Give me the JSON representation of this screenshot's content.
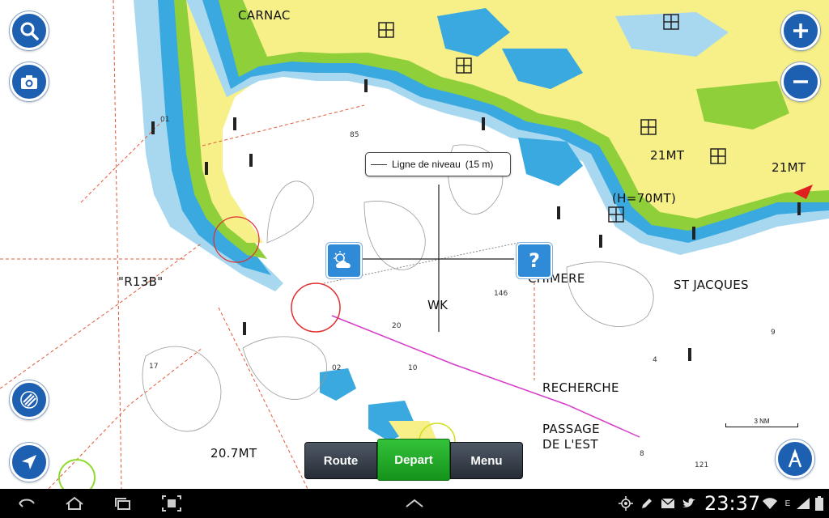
{
  "map": {
    "place_labels": [
      {
        "id": "carnac",
        "text": "CARNAC"
      },
      {
        "id": "r13b",
        "text": "\"R13B\""
      },
      {
        "id": "wk",
        "text": "WK"
      },
      {
        "id": "chimere",
        "text": "CHIMERE"
      },
      {
        "id": "st-jacques",
        "text": "ST JACQUES"
      },
      {
        "id": "recherche",
        "text": "RECHERCHE"
      },
      {
        "id": "passage",
        "text": "PASSAGE"
      },
      {
        "id": "de-lest",
        "text": "DE L'EST"
      },
      {
        "id": "h70mt",
        "text": "(H=70MT)"
      },
      {
        "id": "21mt-a",
        "text": "21MT"
      },
      {
        "id": "21mt-b",
        "text": "21MT"
      },
      {
        "id": "207mt",
        "text": "20.7MT"
      }
    ],
    "depths": [
      "85",
      "20",
      "10",
      "17",
      "146",
      "9",
      "4",
      "121",
      "8",
      "02",
      "01"
    ],
    "scale_label": "3 NM",
    "colors": {
      "land": "#f7ef88",
      "shallow": "#3aa9e0",
      "mid": "#a8d8f0",
      "water": "#ffffff",
      "green": "#8fcf3a"
    }
  },
  "crosshair_tooltip": {
    "text": "Ligne de niveau",
    "value": "(15 m)"
  },
  "buttons": {
    "search": "search-icon",
    "camera": "camera-icon",
    "zoom_in": "plus-icon",
    "zoom_out": "minus-icon",
    "layers": "layers-icon",
    "locate": "navigation-arrow-icon",
    "autorouting": "autorouting-icon",
    "weather": "weather-icon",
    "help": "question-icon"
  },
  "bottom_bar": {
    "route": "Route",
    "depart": "Depart",
    "menu": "Menu"
  },
  "status_bar": {
    "time": "23:37",
    "network": "E"
  }
}
